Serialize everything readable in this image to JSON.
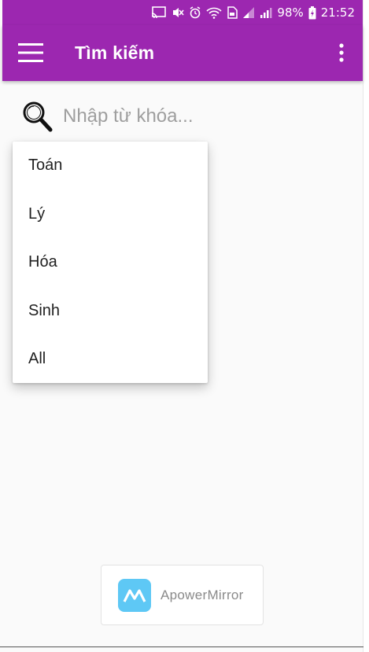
{
  "status_bar": {
    "battery": "98%",
    "time": "21:52",
    "icons": [
      "cast-icon",
      "mute-icon",
      "alarm-icon",
      "wifi-icon",
      "sim-icon",
      "signal-icon",
      "signal-icon",
      "battery-charging-icon"
    ]
  },
  "app_bar": {
    "title": "Tìm kiếm",
    "menu_icon": "hamburger-menu-icon",
    "more_icon": "more-vert-icon",
    "color": "#9c27b0"
  },
  "search": {
    "placeholder": "Nhập từ khóa...",
    "value": "",
    "icon": "search-icon"
  },
  "dropdown": {
    "items": [
      {
        "label": "Toán"
      },
      {
        "label": "Lý"
      },
      {
        "label": "Hóa"
      },
      {
        "label": "Sinh"
      },
      {
        "label": "All"
      }
    ]
  },
  "watermark": {
    "text": "ApowerMirror",
    "logo_icon": "apowermirror-logo-icon",
    "logo_color": "#5ec8f5"
  }
}
